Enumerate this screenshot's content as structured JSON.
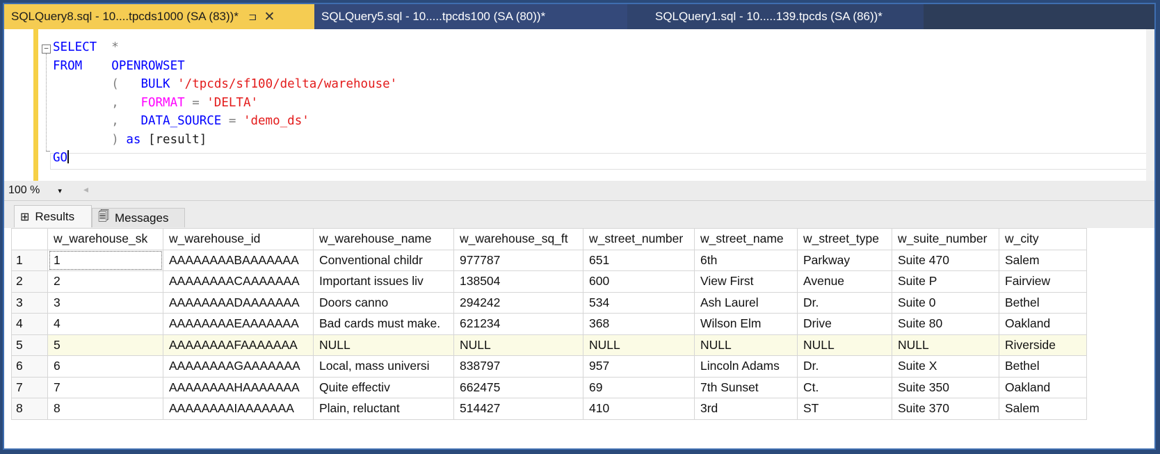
{
  "tabs": [
    {
      "label": "SQLQuery8.sql - 10....tpcds1000 (SA (83))*",
      "pin": "⊐",
      "close": "✕"
    },
    {
      "label": "SQLQuery5.sql - 10.....tpcds100 (SA (80))*"
    },
    {
      "label": "SQLQuery1.sql - 10.....139.tpcds (SA (86))*"
    }
  ],
  "editor": {
    "collapse_glyph": "−",
    "lines": [
      {
        "a": "SELECT",
        "b": "  *"
      },
      {
        "a": "FROM",
        "b": "    OPENROWSET"
      },
      {
        "a": "        (   ",
        "bulk_kw": "BULK",
        "bulk_str": "'/tpcds/sf100/delta/warehouse'"
      },
      {
        "a": "        ,   ",
        "fmt_kw": "FORMAT",
        "eq": " = ",
        "fmt_str": "'DELTA'"
      },
      {
        "a": "        ,   ",
        "ds_kw": "DATA_SOURCE",
        "eq": " = ",
        "ds_str": "'demo_ds'"
      },
      {
        "a": "        ) ",
        "as_kw": "as",
        "rest": " [result]"
      },
      {
        "a": "GO"
      }
    ]
  },
  "zoom": {
    "value": "100 %",
    "arrow": "▾",
    "scroll_left": "◂"
  },
  "result_tabs": {
    "results": "Results",
    "messages": "Messages",
    "results_icon": "⊞",
    "messages_icon": "🗐"
  },
  "grid": {
    "columns": [
      "",
      "w_warehouse_sk",
      "w_warehouse_id",
      "w_warehouse_name",
      "w_warehouse_sq_ft",
      "w_street_number",
      "w_street_name",
      "w_street_type",
      "w_suite_number",
      "w_city"
    ],
    "rows": [
      [
        "1",
        "1",
        "AAAAAAAABAAAAAAA",
        "Conventional childr",
        "977787",
        "651",
        "6th",
        "Parkway",
        "Suite 470",
        "Salem"
      ],
      [
        "2",
        "2",
        "AAAAAAAACAAAAAAA",
        "Important issues liv",
        "138504",
        "600",
        "View First",
        "Avenue",
        "Suite P",
        "Fairview"
      ],
      [
        "3",
        "3",
        "AAAAAAAADAAAAAAA",
        "Doors canno",
        "294242",
        "534",
        "Ash Laurel",
        "Dr.",
        "Suite 0",
        "Bethel"
      ],
      [
        "4",
        "4",
        "AAAAAAAAEAAAAAAA",
        "Bad cards must make.",
        "621234",
        "368",
        "Wilson Elm",
        "Drive",
        "Suite 80",
        "Oakland"
      ],
      [
        "5",
        "5",
        "AAAAAAAAFAAAAAAA",
        "NULL",
        "NULL",
        "NULL",
        "NULL",
        "NULL",
        "NULL",
        "Riverside"
      ],
      [
        "6",
        "6",
        "AAAAAAAAGAAAAAAA",
        "Local, mass universi",
        "838797",
        "957",
        "Lincoln Adams",
        "Dr.",
        "Suite X",
        "Bethel"
      ],
      [
        "7",
        "7",
        "AAAAAAAAHAAAAAAA",
        "Quite effectiv",
        "662475",
        "69",
        "7th Sunset",
        "Ct.",
        "Suite 350",
        "Oakland"
      ],
      [
        "8",
        "8",
        "AAAAAAAAIAAAAAAA",
        "Plain, reluctant",
        "514427",
        "410",
        "3rd",
        "ST",
        "Suite 370",
        "Salem"
      ]
    ]
  }
}
